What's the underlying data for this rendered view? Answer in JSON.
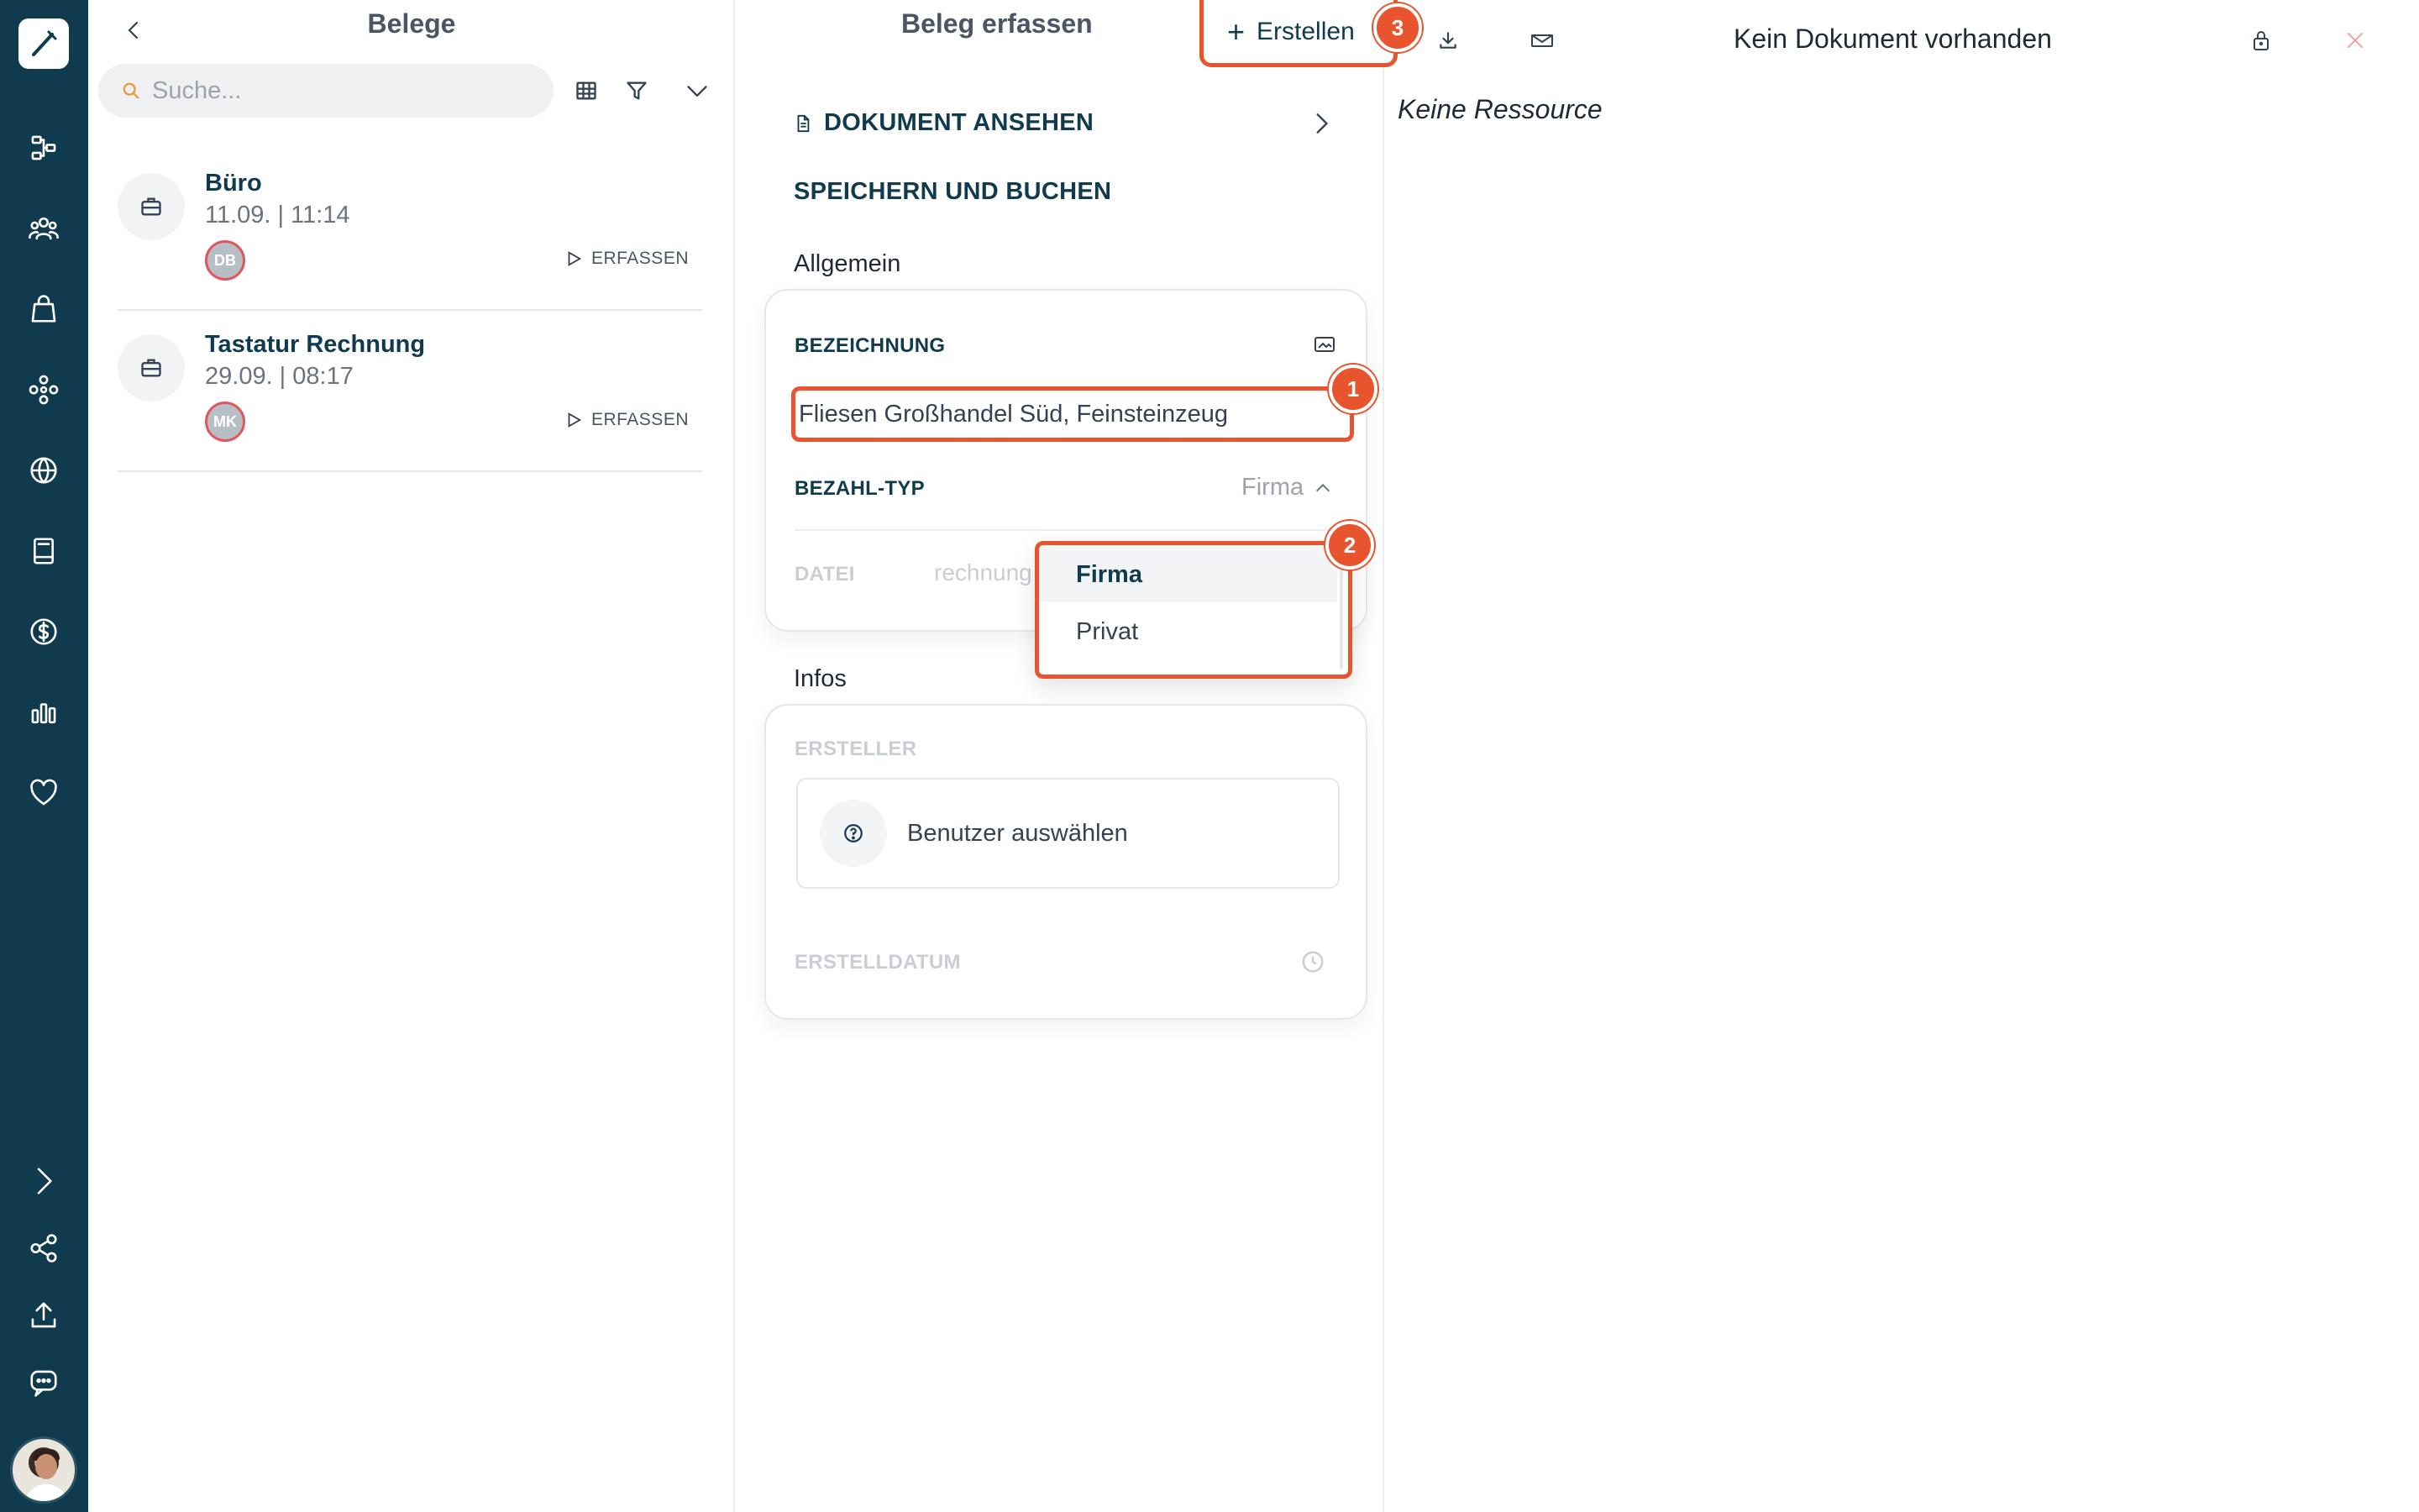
{
  "list": {
    "title": "Belege",
    "search_placeholder": "Suche...",
    "items": [
      {
        "title": "Büro",
        "date": "11.09. | 11:14",
        "initials": "DB",
        "action": "ERFASSEN"
      },
      {
        "title": "Tastatur Rechnung",
        "date": "29.09. | 08:17",
        "initials": "MK",
        "action": "ERFASSEN"
      }
    ]
  },
  "form": {
    "title": "Beleg erfassen",
    "create_label": "Erstellen",
    "view_document": "DOKUMENT ANSEHEN",
    "save_and_book": "SPEICHERN UND BUCHEN",
    "section_general": "Allgemein",
    "label_designation": "BEZEICHNUNG",
    "designation_value": "Fliesen Großhandel Süd, Feinsteinzeug",
    "label_payment_type": "BEZAHL-TYP",
    "payment_type_value": "Firma",
    "label_file": "DATEI",
    "file_value": "rechnung",
    "payment_options": [
      "Firma",
      "Privat"
    ],
    "section_infos": "Infos",
    "label_creator": "ERSTELLER",
    "creator_placeholder": "Benutzer auswählen",
    "label_created_date": "ERSTELLDATUM"
  },
  "markers": [
    "1",
    "2",
    "3"
  ],
  "viewer": {
    "title": "Kein Dokument vorhanden",
    "empty_text": "Keine Ressource"
  },
  "colors": {
    "sidebar": "#103a4d",
    "accent": "#e8542d",
    "text_primary": "#103a4d"
  },
  "icons": {
    "sidebar": [
      "logo-icon",
      "workflow-icon",
      "team-icon",
      "shopping-bag-icon",
      "network-icon",
      "globe-icon",
      "book-icon",
      "dollar-icon",
      "bar-chart-icon",
      "heart-icon",
      "chevron-right-icon",
      "share-icon",
      "upload-icon",
      "chat-icon"
    ]
  }
}
